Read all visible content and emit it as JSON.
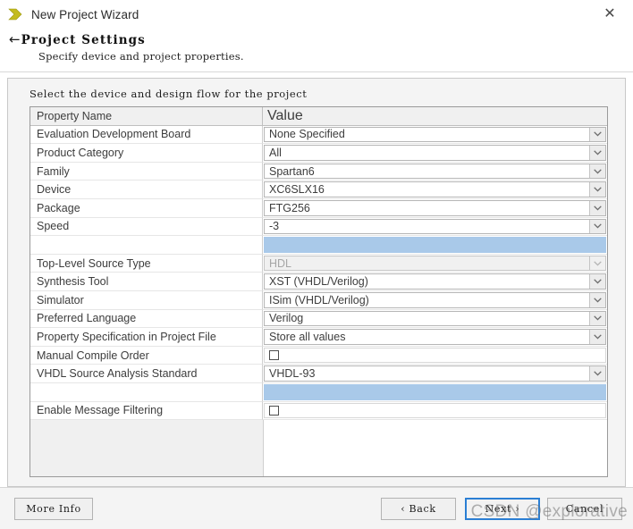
{
  "window": {
    "title": "New Project Wizard",
    "app_icon": "chevron-logo-icon",
    "close_label": "✕"
  },
  "header": {
    "back_arrow": "←",
    "title": "Project Settings",
    "subtitle": "Specify device and project properties."
  },
  "content": {
    "caption": "Select the device and design flow for the project"
  },
  "grid": {
    "columns": [
      "Property Name",
      "Value"
    ],
    "rows": [
      {
        "type": "combo",
        "name": "Evaluation Development Board",
        "value": "None Specified"
      },
      {
        "type": "combo",
        "name": "Product Category",
        "value": "All"
      },
      {
        "type": "combo",
        "name": "Family",
        "value": "Spartan6"
      },
      {
        "type": "combo",
        "name": "Device",
        "value": "XC6SLX16"
      },
      {
        "type": "combo",
        "name": "Package",
        "value": "FTG256"
      },
      {
        "type": "combo",
        "name": "Speed",
        "value": "-3"
      },
      {
        "type": "separator",
        "name": "",
        "value": ""
      },
      {
        "type": "combo-disabled",
        "name": "Top-Level Source Type",
        "value": "HDL"
      },
      {
        "type": "combo",
        "name": "Synthesis Tool",
        "value": "XST (VHDL/Verilog)"
      },
      {
        "type": "combo",
        "name": "Simulator",
        "value": "ISim (VHDL/Verilog)"
      },
      {
        "type": "combo",
        "name": "Preferred Language",
        "value": "Verilog"
      },
      {
        "type": "combo",
        "name": "Property Specification in Project File",
        "value": "Store all values"
      },
      {
        "type": "checkbox",
        "name": "Manual Compile Order",
        "value": "",
        "checked": false
      },
      {
        "type": "combo",
        "name": "VHDL Source Analysis Standard",
        "value": "VHDL-93"
      },
      {
        "type": "separator",
        "name": "",
        "value": ""
      },
      {
        "type": "checkbox",
        "name": "Enable Message Filtering",
        "value": "",
        "checked": false
      }
    ]
  },
  "footer": {
    "more_info": "More Info",
    "back": "‹ Back",
    "next": "Next ›",
    "cancel": "Cancel"
  },
  "watermark": {
    "text": "CSDN @explorative"
  },
  "colors": {
    "accent": "#2b7fd4",
    "selection": "#a9c9e9",
    "logo": "#c3bb1e",
    "panel": "#f4f4f4"
  }
}
